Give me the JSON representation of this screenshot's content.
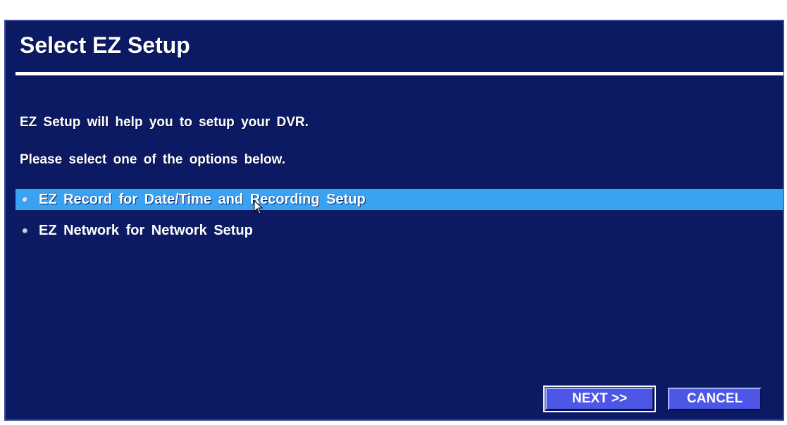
{
  "dialog": {
    "title": "Select EZ Setup",
    "info_line1": "EZ Setup will help you to setup your DVR.",
    "info_line2": "Please select one of the options below."
  },
  "options": [
    {
      "label": "EZ Record for Date/Time and Recording Setup",
      "selected": true
    },
    {
      "label": "EZ Network for Network Setup",
      "selected": false
    }
  ],
  "buttons": {
    "next_label": "NEXT >>",
    "cancel_label": "CANCEL"
  },
  "colors": {
    "panel_background": "#0c1a63",
    "selection_highlight": "#39a2f3",
    "button_face": "#4d57e6",
    "text": "#ffffff"
  },
  "icons": {
    "option_bullet": "radio-bullet-icon",
    "pointer": "mouse-pointer-icon"
  }
}
